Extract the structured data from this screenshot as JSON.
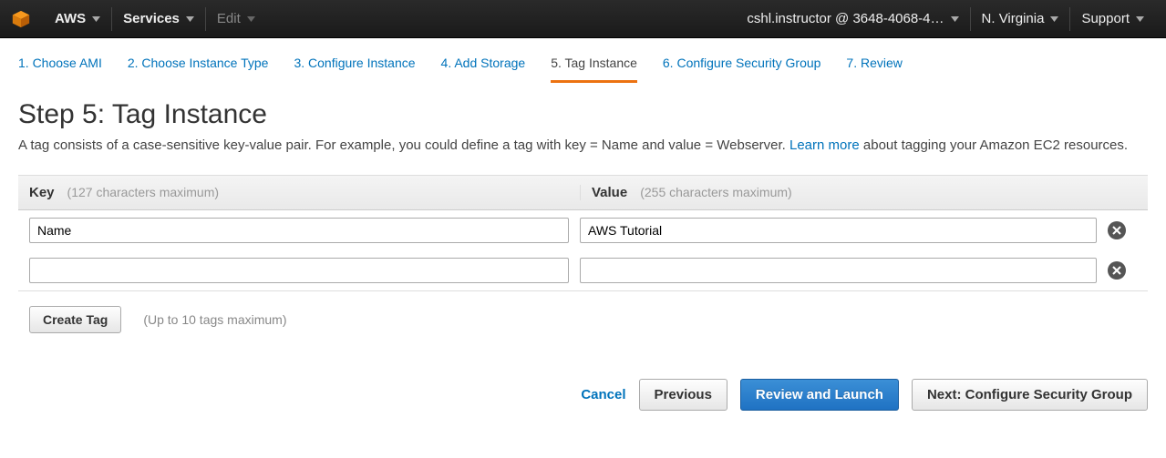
{
  "topbar": {
    "brand": "AWS",
    "services": "Services",
    "edit": "Edit",
    "account": "cshl.instructor @ 3648-4068-4…",
    "region": "N. Virginia",
    "support": "Support"
  },
  "steps": [
    {
      "label": "1. Choose AMI",
      "active": false
    },
    {
      "label": "2. Choose Instance Type",
      "active": false
    },
    {
      "label": "3. Configure Instance",
      "active": false
    },
    {
      "label": "4. Add Storage",
      "active": false
    },
    {
      "label": "5. Tag Instance",
      "active": true
    },
    {
      "label": "6. Configure Security Group",
      "active": false
    },
    {
      "label": "7. Review",
      "active": false
    }
  ],
  "heading": "Step 5: Tag Instance",
  "description": {
    "pre": "A tag consists of a case-sensitive key-value pair. For example, you could define a tag with key = Name and value = Webserver. ",
    "link": "Learn more",
    "post": " about tagging your Amazon EC2 resources."
  },
  "table": {
    "key_label": "Key",
    "key_hint": "(127 characters maximum)",
    "value_label": "Value",
    "value_hint": "(255 characters maximum)",
    "rows": [
      {
        "key": "Name",
        "value": "AWS Tutorial"
      },
      {
        "key": "",
        "value": ""
      }
    ]
  },
  "create_tag": "Create Tag",
  "create_hint": "(Up to 10 tags maximum)",
  "footer": {
    "cancel": "Cancel",
    "previous": "Previous",
    "review": "Review and Launch",
    "next": "Next: Configure Security Group"
  }
}
